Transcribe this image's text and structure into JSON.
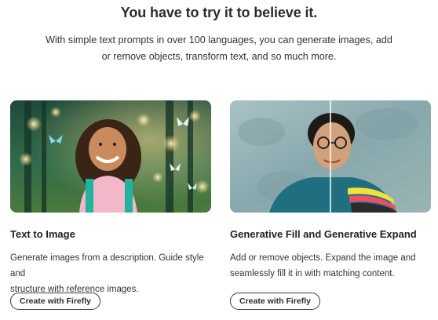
{
  "header": {
    "title": "You have to try it to believe it.",
    "subtitle_line1": "With simple text prompts in over 100 languages, you can generate images, add",
    "subtitle_line2": "or remove objects, transform text, and so much more."
  },
  "cards": [
    {
      "title": "Text to Image",
      "desc_line1": "Generate images from a description. Guide style and",
      "desc_line2": "structure with reference images.",
      "button_label": "Create with Firefly"
    },
    {
      "title": "Generative Fill and Generative Expand",
      "desc_line1": "Add or remove objects. Expand the image and",
      "desc_line2": "seamlessly fill it in with matching content.",
      "button_label": "Create with Firefly"
    }
  ],
  "colors": {
    "text": "#2c2c2c",
    "button_border": "#3a3a3a"
  }
}
